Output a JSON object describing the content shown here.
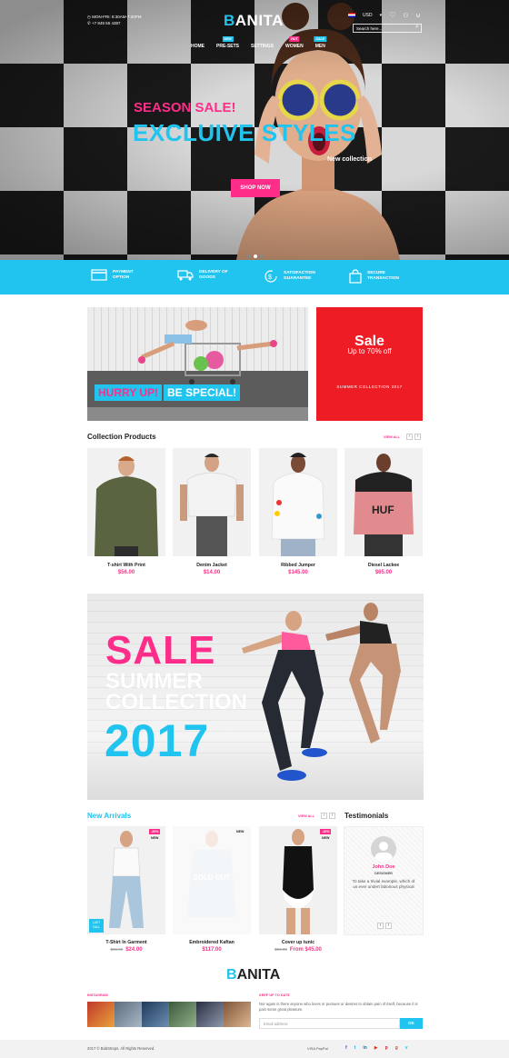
{
  "header": {
    "hours": "MON-FRI: 8:30AM-7:30PM",
    "phone": "+7 849 55 4387",
    "logo_first": "B",
    "logo_rest": "ANITA",
    "currency": "USD",
    "search_placeholder": "Search here...",
    "nav": [
      {
        "label": "HOME",
        "tag": ""
      },
      {
        "label": "PRE-SETS",
        "tag": "NEW"
      },
      {
        "label": "SETTINGS",
        "tag": ""
      },
      {
        "label": "WOMEN",
        "tag": "HOT"
      },
      {
        "label": "MEN",
        "tag": "SALE"
      }
    ]
  },
  "hero": {
    "pink_text": "SEASON SALE!",
    "cyan_text": "EXCLUIVE STYLES",
    "sub_text": "New collection",
    "button": "SHOP NOW"
  },
  "features": [
    {
      "line1": "PAYMENT",
      "line2": "OPTION",
      "icon": "card-icon"
    },
    {
      "line1": "DELIVERY OF",
      "line2": "GOODS",
      "icon": "truck-icon"
    },
    {
      "line1": "SATISFACTION",
      "line2": "GUARANTEE",
      "icon": "refresh-icon"
    },
    {
      "line1": "SECURE",
      "line2": "TRANSACTION",
      "icon": "bag-icon"
    }
  ],
  "promo": {
    "hurry": "HURRY UP!",
    "special": "BE SPECIAL!",
    "sale": "Sale",
    "upto": "Up to 70% off",
    "collection": "SUMMER COLLECTION 2017"
  },
  "collection": {
    "title": "Collection Products",
    "view_all": "VIEW ALL",
    "items": [
      {
        "name": "T-shirt With Print",
        "price": "$56.00"
      },
      {
        "name": "Denim Jacket",
        "price": "$14.00"
      },
      {
        "name": "Ribbed Jumper",
        "price": "$145.00"
      },
      {
        "name": "Diesel Lackee",
        "price": "$65.00"
      }
    ]
  },
  "summer": {
    "sale": "SALE",
    "summer": "SUMMER",
    "collection": "COLLECTION",
    "year": "2017"
  },
  "arrivals": {
    "title": "New Arrivals",
    "view_all": "VIEW ALL",
    "items": [
      {
        "name": "T-Shirt In Garment",
        "old": "$30.00",
        "price": "$24.00",
        "badge": "-20%",
        "badge2": "NEW",
        "promo": "LAST CALL"
      },
      {
        "name": "Embroidered Kaftan",
        "old": "",
        "price": "$117.00",
        "badge": "",
        "badge2": "NEW",
        "soldout": "SOLD OUT"
      },
      {
        "name": "Cover up tunic",
        "old": "$50.00",
        "price": "From $45.00",
        "badge": "-10%",
        "badge2": "NEW"
      }
    ]
  },
  "testimonials": {
    "title": "Testimonials",
    "name": "John Doe",
    "role": "DESIGNER",
    "quote": "To take a trivial example, which of us ever undert laborious physical"
  },
  "footer": {
    "logo_first": "B",
    "logo_rest": "ANITA",
    "instagram": "INSTAGRAM",
    "keep": "KEEP UP TO DATE",
    "text": "Nor again is there anyone who loves or pursues or desires to obtain pain of itself, because it is pain some great pleasure.",
    "email_placeholder": "Email address",
    "ok": "OK",
    "copyright": "2017 © BabStreps. All Rights Reserved.",
    "payments": "VISA PayPal"
  },
  "colors": {
    "pink": "#ff2d8a",
    "cyan": "#21c4ef",
    "red": "#ee1c25"
  }
}
